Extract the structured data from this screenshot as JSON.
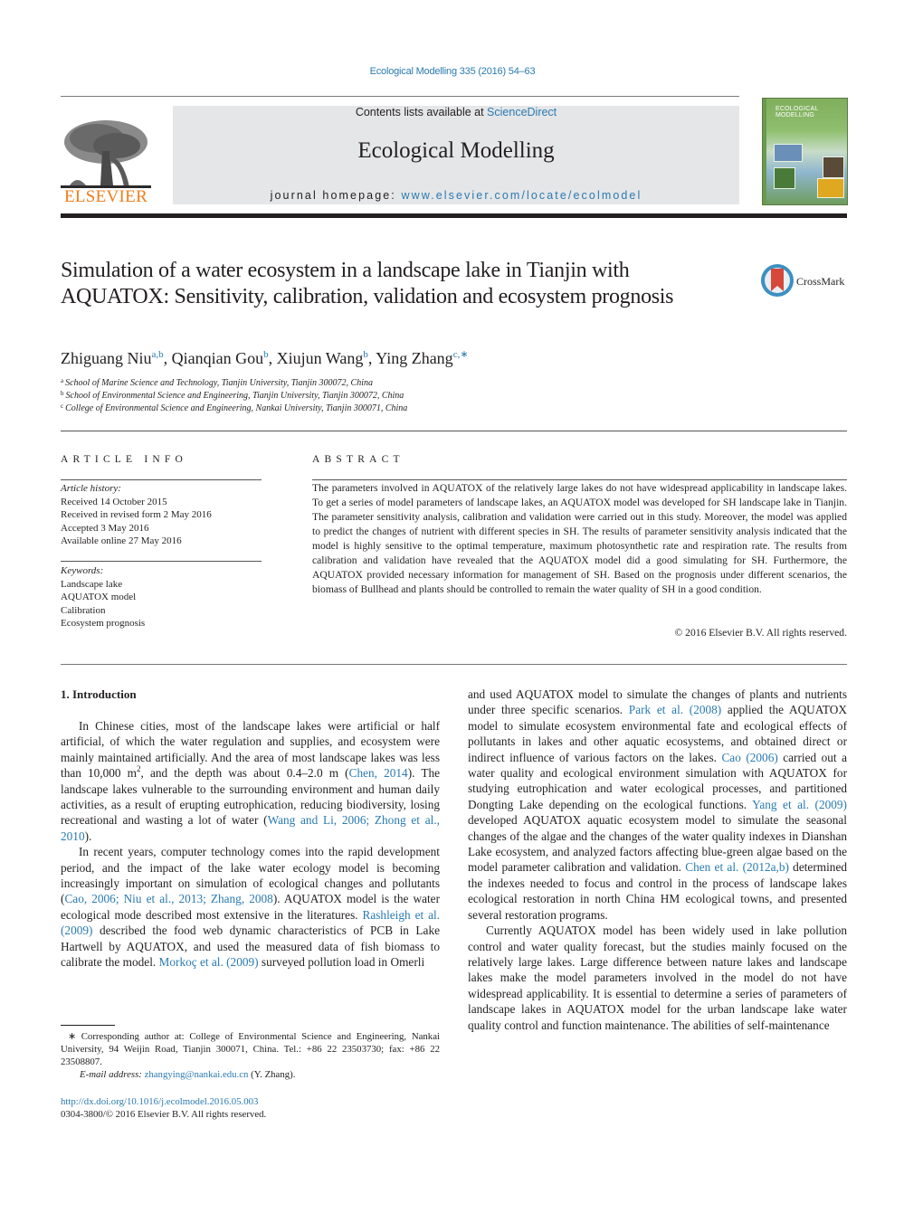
{
  "header": {
    "journal_ref": "Ecological Modelling 335 (2016) 54–63",
    "contents_prefix": "Contents lists available at ",
    "contents_link": "ScienceDirect",
    "journal_title": "Ecological Modelling",
    "homepage_prefix": "journal homepage: ",
    "homepage_link": "www.elsevier.com/locate/ecolmodel",
    "publisher_logo_text": "ELSEVIER",
    "cover_title_line1": "ECOLOGICAL",
    "cover_title_line2": "MODELLING",
    "crossmark_label": "CrossMark"
  },
  "colors": {
    "link": "#2a7ab0",
    "elsevier_orange": "#f07d1a",
    "masthead_bg": "#e5e6e8",
    "text": "#231f20"
  },
  "article": {
    "title": "Simulation of a water ecosystem in a landscape lake in Tianjin with AQUATOX: Sensitivity, calibration, validation and ecosystem prognosis",
    "authors": [
      {
        "name": "Zhiguang Niu",
        "sup": "a,b"
      },
      {
        "name": "Qianqian Gou",
        "sup": "b"
      },
      {
        "name": "Xiujun Wang",
        "sup": "b"
      },
      {
        "name": "Ying Zhang",
        "sup": "c,∗"
      }
    ],
    "affiliations": [
      {
        "mark": "a",
        "text": "School of Marine Science and Technology, Tianjin University, Tianjin 300072, China"
      },
      {
        "mark": "b",
        "text": "School of Environmental Science and Engineering, Tianjin University, Tianjin 300072, China"
      },
      {
        "mark": "c",
        "text": "College of Environmental Science and Engineering, Nankai University, Tianjin 300071, China"
      }
    ]
  },
  "article_info": {
    "heading": "ARTICLE INFO",
    "history_label": "Article history:",
    "history": [
      "Received 14 October 2015",
      "Received in revised form 2 May 2016",
      "Accepted 3 May 2016",
      "Available online 27 May 2016"
    ],
    "keywords_label": "Keywords:",
    "keywords": [
      "Landscape lake",
      "AQUATOX model",
      "Calibration",
      "Ecosystem prognosis"
    ]
  },
  "abstract": {
    "heading": "ABSTRACT",
    "text": "The parameters involved in AQUATOX of the relatively large lakes do not have widespread applicability in landscape lakes. To get a series of model parameters of landscape lakes, an AQUATOX model was developed for SH landscape lake in Tianjin. The parameter sensitivity analysis, calibration and validation were carried out in this study. Moreover, the model was applied to predict the changes of nutrient with different species in SH. The results of parameter sensitivity analysis indicated that the model is highly sensitive to the optimal temperature, maximum photosynthetic rate and respiration rate. The results from calibration and validation have revealed that the AQUATOX model did a good simulating for SH. Furthermore, the AQUATOX provided necessary information for management of SH. Based on the prognosis under different scenarios, the biomass of Bullhead and plants should be controlled to remain the water quality of SH in a good condition.",
    "copyright": "© 2016 Elsevier B.V. All rights reserved."
  },
  "body": {
    "intro_heading": "1.  Introduction",
    "p1": {
      "t1": "In Chinese cities, most of the landscape lakes were artificial or half artificial, of which the water regulation and supplies, and ecosystem were mainly maintained artificially. And the area of most landscape lakes was less than 10,000 m",
      "sup": "2",
      "t2": ", and the depth was about 0.4–2.0 m (",
      "ref1": "Chen, 2014",
      "t3": "). The landscape lakes vulnerable to the surrounding environment and human daily activities, as a result of erupting eutrophication, reducing biodiversity, losing recreational and wasting a lot of water (",
      "ref2": "Wang and Li, 2006; Zhong et al., 2010",
      "t4": ")."
    },
    "p2": {
      "t1": "In recent years, computer technology comes into the rapid development period, and the impact of the lake water ecology model is becoming increasingly important on simulation of ecological changes and pollutants (",
      "ref1": "Cao, 2006; Niu et al., 2013; Zhang, 2008",
      "t2": "). AQUATOX model is the water ecological mode described most extensive in the literatures. ",
      "ref2": "Rashleigh et al. (2009)",
      "t3": " described the food web dynamic characteristics of PCB in Lake Hartwell by AQUATOX, and used the measured data of fish biomass to calibrate the model. ",
      "ref3": "Morkoç et al. (2009)",
      "t4": " surveyed pollution load in Omerli"
    },
    "p3": {
      "t1": "and used AQUATOX model to simulate the changes of plants and nutrients under three specific scenarios. ",
      "ref1": "Park et al. (2008)",
      "t2": " applied the AQUATOX model to simulate ecosystem environmental fate and ecological effects of pollutants in lakes and other aquatic ecosystems, and obtained direct or indirect influence of various factors on the lakes. ",
      "ref2": "Cao (2006)",
      "t3": " carried out a water quality and ecological environment simulation with AQUATOX for studying eutrophication and water ecological processes, and partitioned Dongting Lake depending on the ecological functions. ",
      "ref3": "Yang et al. (2009)",
      "t4": " developed AQUATOX aquatic ecosystem model to simulate the seasonal changes of the algae and the changes of the water quality indexes in Dianshan Lake ecosystem, and analyzed factors affecting blue-green algae based on the model parameter calibration and validation. ",
      "ref4": "Chen et al. (2012a,b)",
      "t5": " determined the indexes needed to focus and control in the process of landscape lakes ecological restoration in north China HM ecological towns, and presented several restoration programs."
    },
    "p4": "Currently AQUATOX model has been widely used in lake pollution control and water quality forecast, but the studies mainly focused on the relatively large lakes. Large difference between nature lakes and landscape lakes make the model parameters involved in the model do not have widespread applicability. It is essential to determine a series of parameters of landscape lakes in AQUATOX model for the urban landscape lake water quality control and function maintenance. The abilities of self-maintenance"
  },
  "footnote": {
    "corresponding": "∗  Corresponding author at: College of Environmental Science and Engineering, Nankai University, 94 Weijin Road, Tianjin 300071, China. Tel.: +86 22 23503730; fax: +86 22 23508807.",
    "email_label": "E-mail address: ",
    "email": "zhangying@nankai.edu.cn",
    "email_suffix": " (Y. Zhang).",
    "doi": "http://dx.doi.org/10.1016/j.ecolmodel.2016.05.003",
    "issn": "0304-3800/© 2016 Elsevier B.V. All rights reserved."
  }
}
